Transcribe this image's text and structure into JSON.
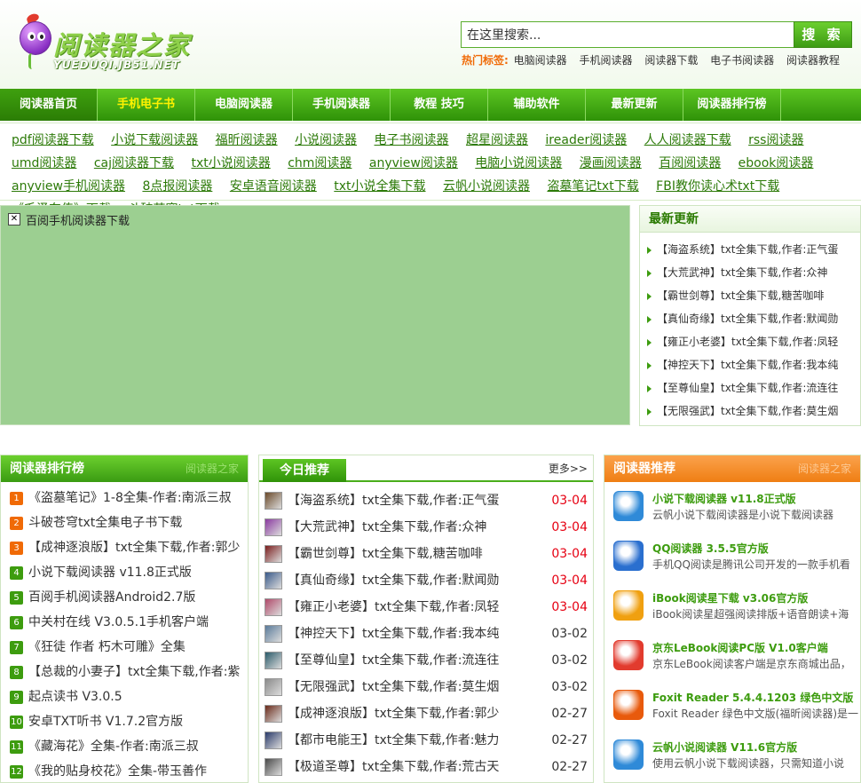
{
  "header": {
    "logo_title": "阅读器之家",
    "logo_url": "YUEDUQI.JB51.NET",
    "search_placeholder": "在这里搜索...",
    "search_button": "搜 索",
    "hot_label": "热门标签:",
    "hot_tags": [
      "电脑阅读器",
      "手机阅读器",
      "阅读器下载",
      "电子书阅读器",
      "阅读器教程"
    ]
  },
  "nav": {
    "items": [
      {
        "label": "阅读器首页"
      },
      {
        "label": "手机电子书"
      },
      {
        "label": "电脑阅读器"
      },
      {
        "label": "手机阅读器"
      },
      {
        "label": "教程 技巧"
      },
      {
        "label": "辅助软件"
      },
      {
        "label": "最新更新"
      },
      {
        "label": "阅读器排行榜"
      }
    ]
  },
  "link_bar": [
    "pdf阅读器下载",
    "小说下载阅读器",
    "福昕阅读器",
    "小说阅读器",
    "电子书阅读器",
    "超星阅读器",
    "ireader阅读器",
    "人人阅读器下载",
    "rss阅读器",
    "umd阅读器",
    "caj阅读器下载",
    "txt小说阅读器",
    "chm阅读器",
    "anyview阅读器",
    "电脑小说阅读器",
    "漫画阅读器",
    "百阅阅读器",
    "ebook阅读器",
    "anyview手机阅读器",
    "8点报阅读器",
    "安卓语音阅读器",
    "txt小说全集下载",
    "云帆小说阅读器",
    "盗墓笔记txt下载",
    "FBI教你读心术txt下载",
    "《毛泽东传》下载",
    "斗破苍穹txt下载"
  ],
  "banner": {
    "alt_text": "百阅手机阅读器下载"
  },
  "latest": {
    "title": "最新更新",
    "items": [
      "【海盗系统】txt全集下载,作者:正气蛋",
      "【大荒武神】txt全集下载,作者:众神",
      "【霸世剑尊】txt全集下载,糖苦咖啡",
      "【真仙奇缘】txt全集下载,作者:默闻勋",
      "【雍正小老婆】txt全集下载,作者:凤轻",
      "【神控天下】txt全集下载,作者:我本纯",
      "【至尊仙皇】txt全集下载,作者:流连往",
      "【无限强武】txt全集下载,作者:莫生烟"
    ]
  },
  "rank": {
    "title": "阅读器排行榜",
    "subtitle": "阅读器之家",
    "items": [
      {
        "num": "1",
        "text": "《盗墓笔记》1-8全集-作者:南派三叔"
      },
      {
        "num": "2",
        "text": "斗破苍穹txt全集电子书下载"
      },
      {
        "num": "3",
        "text": "【成神逐浪版】txt全集下载,作者:郭少"
      },
      {
        "num": "4",
        "text": "小说下载阅读器 v11.8正式版"
      },
      {
        "num": "5",
        "text": "百阅手机阅读器Android2.7版"
      },
      {
        "num": "6",
        "text": "中关村在线 V3.0.5.1手机客户端"
      },
      {
        "num": "7",
        "text": "《狂徒 作者 朽木可雕》全集"
      },
      {
        "num": "8",
        "text": "【总裁的小妻子】txt全集下载,作者:紫"
      },
      {
        "num": "9",
        "text": "起点读书 V3.0.5"
      },
      {
        "num": "10",
        "text": "安卓TXT听书 V1.7.2官方版"
      },
      {
        "num": "11",
        "text": "《藏海花》全集-作者:南派三叔"
      },
      {
        "num": "12",
        "text": "《我的贴身校花》全集-带玉善作"
      }
    ]
  },
  "today": {
    "tab": "今日推荐",
    "more": "更多>>",
    "items": [
      {
        "text": "【海盗系统】txt全集下载,作者:正气蛋",
        "date": "03-04",
        "new": true
      },
      {
        "text": "【大荒武神】txt全集下载,作者:众神",
        "date": "03-04",
        "new": true
      },
      {
        "text": "【霸世剑尊】txt全集下载,糖苦咖啡",
        "date": "03-04",
        "new": true
      },
      {
        "text": "【真仙奇缘】txt全集下载,作者:默闻勋",
        "date": "03-04",
        "new": true
      },
      {
        "text": "【雍正小老婆】txt全集下载,作者:凤轻",
        "date": "03-04",
        "new": true
      },
      {
        "text": "【神控天下】txt全集下载,作者:我本纯",
        "date": "03-02",
        "new": false
      },
      {
        "text": "【至尊仙皇】txt全集下载,作者:流连往",
        "date": "03-02",
        "new": false
      },
      {
        "text": "【无限强武】txt全集下载,作者:莫生烟",
        "date": "03-02",
        "new": false
      },
      {
        "text": "【成神逐浪版】txt全集下载,作者:郭少",
        "date": "02-27",
        "new": false
      },
      {
        "text": "【都市电能王】txt全集下载,作者:魅力",
        "date": "02-27",
        "new": false
      },
      {
        "text": "【极道圣尊】txt全集下载,作者:荒古天",
        "date": "02-27",
        "new": false
      }
    ]
  },
  "recommend": {
    "title": "阅读器推荐",
    "subtitle": "阅读器之家",
    "items": [
      {
        "title": "小说下载阅读器 v11.8正式版",
        "desc": "云帆小说下载阅读器是小说下载阅读器",
        "icon": "book-stack-icon",
        "color": "#2f8ad8"
      },
      {
        "title": "QQ阅读器 3.5.5官方版",
        "desc": "手机QQ阅读是腾讯公司开发的一款手机看",
        "icon": "qq-penguin-icon",
        "color": "#2a6fcf"
      },
      {
        "title": "iBook阅读星下载 v3.06官方版",
        "desc": "iBook阅读星超强阅读排版+语音朗读+海",
        "icon": "ibook-star-icon",
        "color": "#f0a010"
      },
      {
        "title": "京东LeBook阅读PC版 V1.0客户端",
        "desc": "京东LeBook阅读客户端是京东商城出品，",
        "icon": "jingdong-icon",
        "color": "#e23b2e"
      },
      {
        "title": "Foxit Reader 5.4.4.1203 绿色中文版",
        "desc": "Foxit Reader 绿色中文版(福昕阅读器)是一",
        "icon": "foxit-icon",
        "color": "#e85a0c"
      },
      {
        "title": "云帆小说阅读器 V11.6官方版",
        "desc": "使用云帆小说下载阅读器，只需知道小说",
        "icon": "yunfan-icon",
        "color": "#2f8ad8"
      }
    ]
  },
  "colors": {
    "nav_green": "#3fa00f",
    "link_green": "#2c7a08",
    "accent_orange": "#f06a06",
    "date_red": "#e60012"
  }
}
